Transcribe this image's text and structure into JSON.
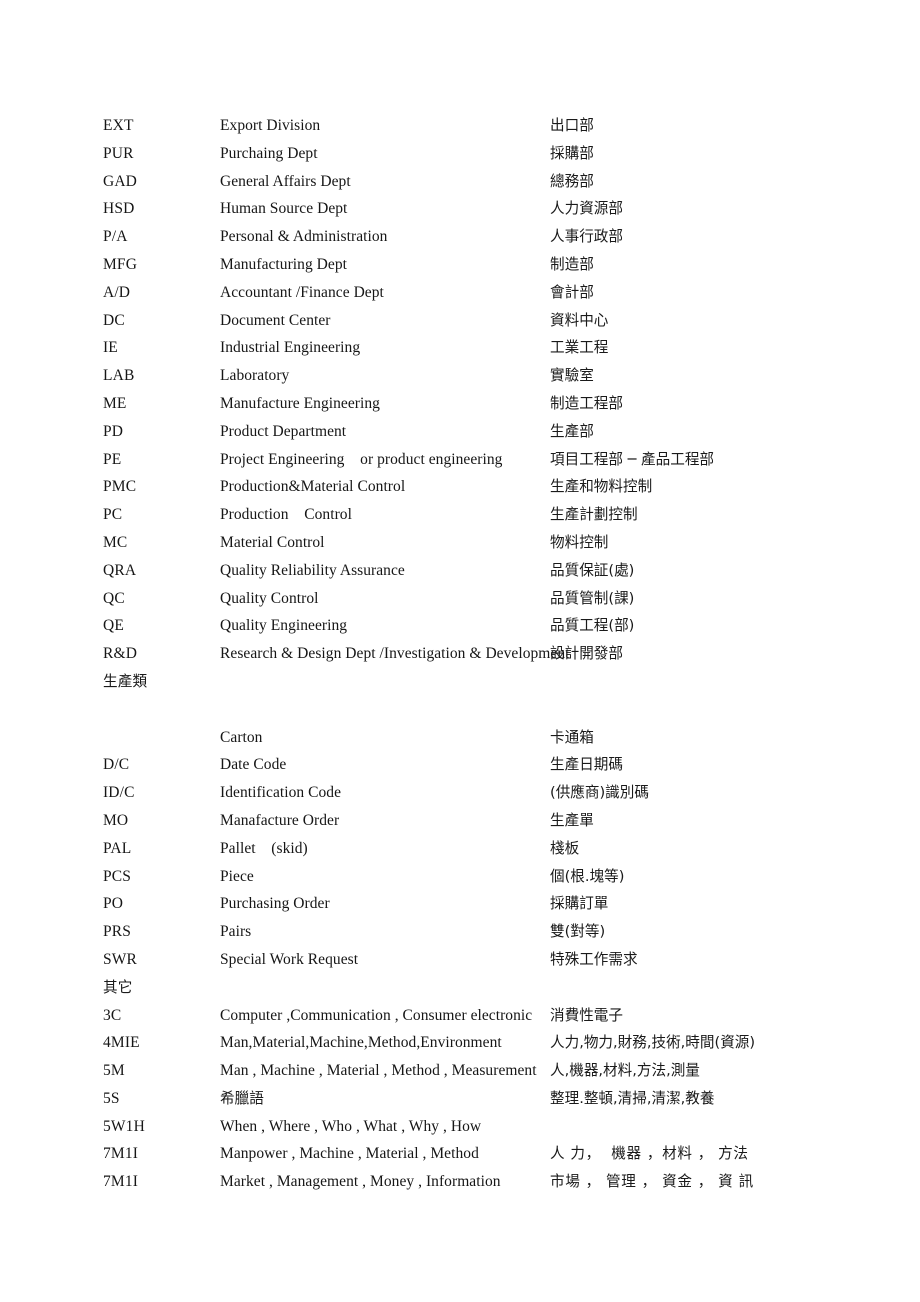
{
  "document": {
    "type": "glossary-table",
    "columns": [
      "abbreviation",
      "english",
      "chinese"
    ],
    "rows": [
      {
        "abbr": "EXT",
        "en": "Export Division",
        "zh": "出口部"
      },
      {
        "abbr": "PUR",
        "en": "Purchaing Dept",
        "zh": "採購部"
      },
      {
        "abbr": "GAD",
        "en": "General Affairs Dept",
        "zh": "總務部"
      },
      {
        "abbr": "HSD",
        "en": "Human Source Dept",
        "zh": "人力資源部"
      },
      {
        "abbr": "P/A",
        "en": "Personal & Administration",
        "zh": "人事行政部"
      },
      {
        "abbr": "MFG",
        "en": "Manufacturing Dept",
        "zh": "制造部"
      },
      {
        "abbr": "A/D",
        "en": "Accountant /Finance Dept",
        "zh": "會計部"
      },
      {
        "abbr": "DC",
        "en": "Document Center",
        "zh": "資料中心"
      },
      {
        "abbr": "IE",
        "en": "Industrial Engineering",
        "zh": "工業工程"
      },
      {
        "abbr": "LAB",
        "en": "Laboratory",
        "zh": "實驗室"
      },
      {
        "abbr": "ME",
        "en": "Manufacture Engineering",
        "zh": "制造工程部"
      },
      {
        "abbr": "PD",
        "en": "Product Department",
        "zh": "生產部"
      },
      {
        "abbr": "PE",
        "en": "Project Engineering    or product engineering",
        "zh": "項目工程部 ─ 產品工程部"
      },
      {
        "abbr": "PMC",
        "en": "Production&Material Control",
        "zh": "生產和物料控制"
      },
      {
        "abbr": "PC",
        "en": "Production    Control",
        "zh": "生產計劃控制"
      },
      {
        "abbr": "MC",
        "en": "Material Control",
        "zh": "物料控制"
      },
      {
        "abbr": "QRA",
        "en": "Quality Reliability Assurance",
        "zh": "品質保証(處)"
      },
      {
        "abbr": "QC",
        "en": "Quality Control",
        "zh": "品質管制(課)"
      },
      {
        "abbr": "QE",
        "en": "Quality Engineering",
        "zh": "品質工程(部)"
      },
      {
        "abbr": "R&D",
        "en": "Research & Design Dept /Investigation & Development",
        "zh": "設計開發部"
      },
      {
        "abbr": "生產類",
        "en": "",
        "zh": "",
        "heading": true
      },
      {
        "abbr": "",
        "en": "",
        "zh": "",
        "spacer": true
      },
      {
        "abbr": "",
        "en": "Carton",
        "zh": "卡通箱"
      },
      {
        "abbr": "D/C",
        "en": "Date Code",
        "zh": "生產日期碼"
      },
      {
        "abbr": "ID/C",
        "en": "Identification Code",
        "zh": "(供應商)識別碼"
      },
      {
        "abbr": "MO",
        "en": "Manafacture Order",
        "zh": "生產單"
      },
      {
        "abbr": "PAL",
        "en": "Pallet    (skid)",
        "zh": "棧板"
      },
      {
        "abbr": "PCS",
        "en": "Piece",
        "zh": "個(根.塊等)"
      },
      {
        "abbr": "PO",
        "en": "Purchasing Order",
        "zh": "採購訂單"
      },
      {
        "abbr": "PRS",
        "en": "Pairs",
        "zh": "雙(對等)"
      },
      {
        "abbr": "SWR",
        "en": "Special Work Request",
        "zh": "特殊工作需求"
      },
      {
        "abbr": "其它",
        "en": "",
        "zh": "",
        "heading": true
      },
      {
        "abbr": "3C",
        "en": "Computer ,Communication , Consumer electronic",
        "zh": "消費性電子"
      },
      {
        "abbr": "4MIE",
        "en": "Man,Material,Machine,Method,Environment",
        "zh": "人力,物力,財務,技術,時間(資源)"
      },
      {
        "abbr": "5M",
        "en": "Man , Machine , Material , Method , Measurement",
        "zh": "人,機器,材料,方法,測量"
      },
      {
        "abbr": "5S",
        "en": "希臘語",
        "zh": "整理.整頓,清掃,清潔,教養",
        "en_is_chinese": true
      },
      {
        "abbr": "5W1H",
        "en": "When , Where , Who , What , Why , How",
        "zh": ""
      },
      {
        "abbr": "7M1I",
        "en": "Manpower , Machine , Material , Method",
        "zh": "人 力，  機器 ，材料 ， 方法",
        "zh_tracked": true
      },
      {
        "abbr": "7M1I",
        "en": "Market , Management , Money , Information",
        "zh": "市場 ， 管理 ， 資金 ， 資 訊",
        "zh_tracked": true
      }
    ]
  }
}
